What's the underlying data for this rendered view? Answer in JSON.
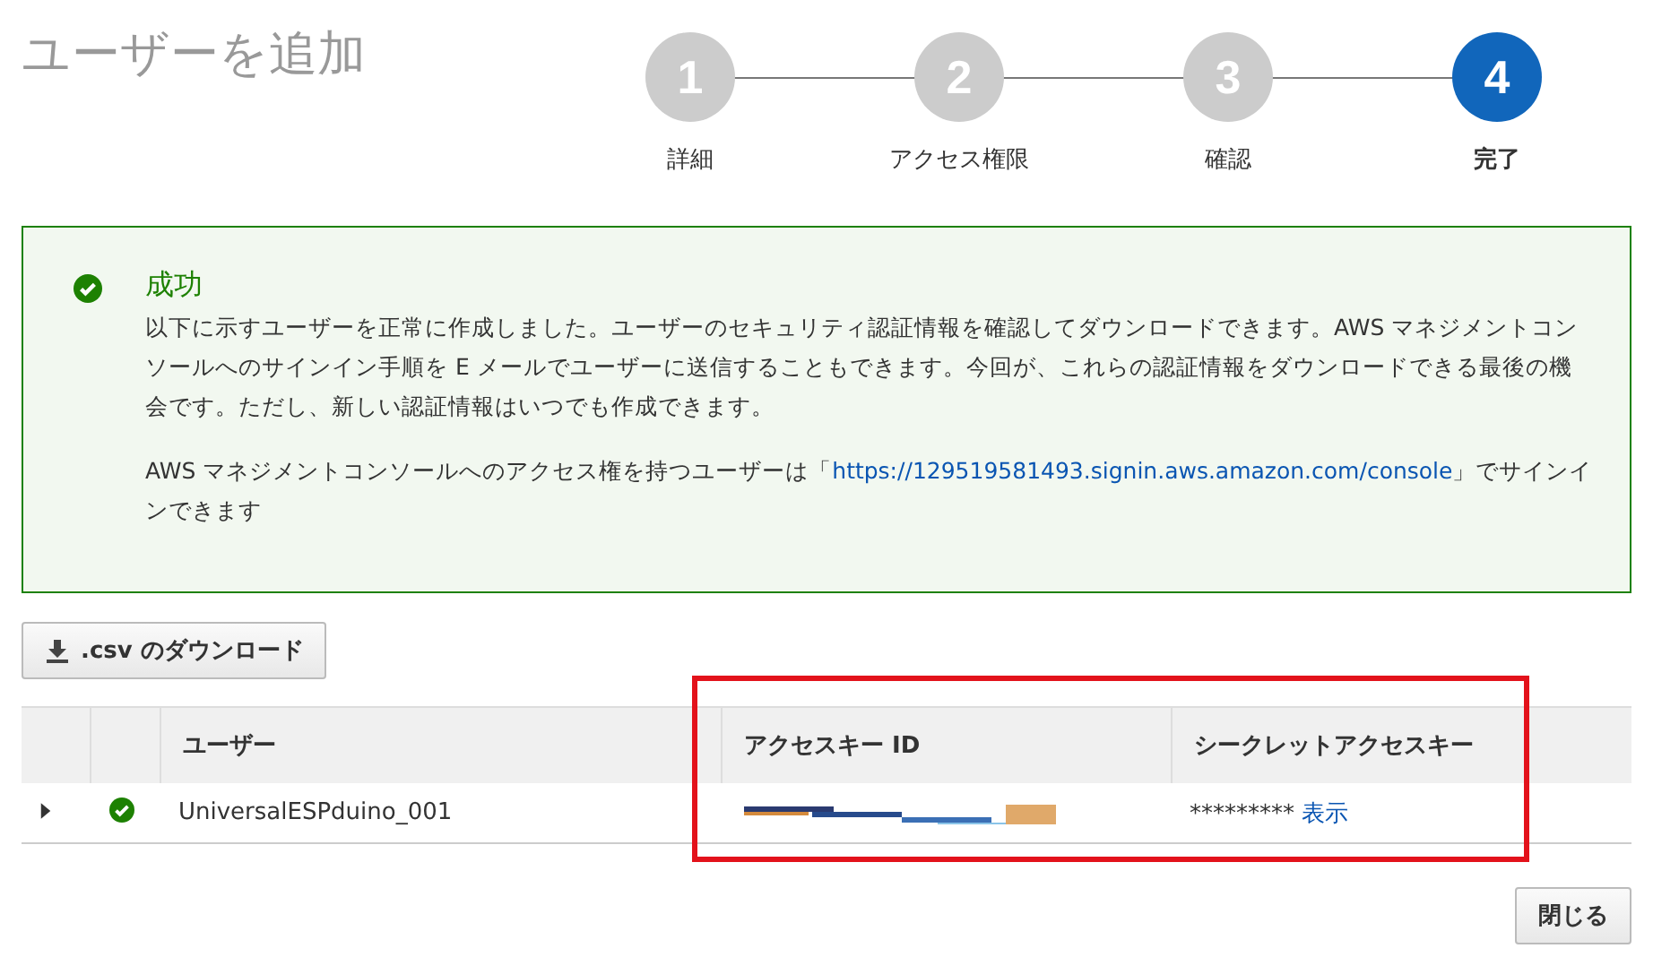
{
  "page_title": "ユーザーを追加",
  "steps": [
    {
      "number": "1",
      "label": "詳細",
      "selected": false
    },
    {
      "number": "2",
      "label": "アクセス権限",
      "selected": false
    },
    {
      "number": "3",
      "label": "確認",
      "selected": false
    },
    {
      "number": "4",
      "label": "完了",
      "selected": true
    }
  ],
  "alert": {
    "title": "成功",
    "message": "以下に示すユーザーを正常に作成しました。ユーザーのセキュリティ認証情報を確認してダウンロードできます。AWS マネジメントコンソールへのサインイン手順を E メールでユーザーに送信することもできます。今回が、これらの認証情報をダウンロードできる最後の機会です。ただし、新しい認証情報はいつでも作成できます。",
    "signin_before": "AWS マネジメントコンソールへのアクセス権を持つユーザーは「",
    "signin_link": "https://129519581493.signin.aws.amazon.com/console",
    "signin_after": "」でサインインできます"
  },
  "download_button": ".csv のダウンロード",
  "table": {
    "columns": [
      "ユーザー",
      "アクセスキー ID",
      "シークレットアクセスキー"
    ],
    "rows": [
      {
        "expanded": false,
        "user": "UniversalESPduino_001",
        "secret_mask": "*********",
        "show_link": "表示"
      }
    ]
  },
  "close_button": "閉じる"
}
